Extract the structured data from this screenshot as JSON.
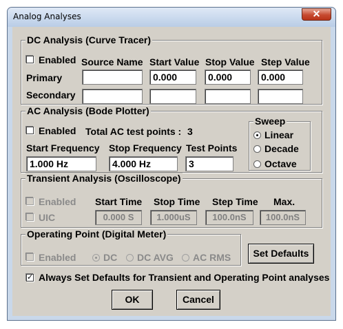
{
  "window": {
    "title": "Analog Analyses",
    "close_glyph": "✕"
  },
  "dc": {
    "legend": "DC Analysis  (Curve Tracer)",
    "enabled_label": "Enabled",
    "headers": {
      "source_name": "Source Name",
      "start_value": "Start Value",
      "stop_value": "Stop Value",
      "step_value": "Step Value"
    },
    "primary_label": "Primary",
    "secondary_label": "Secondary",
    "primary": {
      "source": "",
      "start": "0.000",
      "stop": "0.000",
      "step": "0.000"
    },
    "secondary": {
      "source": "",
      "start": "",
      "stop": "",
      "step": ""
    }
  },
  "ac": {
    "legend": "AC Analysis  (Bode Plotter)",
    "enabled_label": "Enabled",
    "total_label": "Total  AC test points :",
    "total_value": "3",
    "start_freq_label": "Start Frequency",
    "stop_freq_label": "Stop Frequency",
    "test_points_label": "Test Points",
    "start_freq": "1.000 Hz",
    "stop_freq": "4.000 Hz",
    "test_points": "3",
    "sweep": {
      "legend": "Sweep",
      "options": [
        "Linear",
        "Decade",
        "Octave"
      ],
      "selected": "Linear"
    }
  },
  "transient": {
    "legend": "Transient Analysis  (Oscilloscope)",
    "enabled_label": "Enabled",
    "uic_label": "UIC",
    "headers": {
      "start": "Start Time",
      "stop": "Stop Time",
      "step": "Step Time",
      "max": "Max."
    },
    "values": {
      "start": "0.000 S",
      "stop": "1.000uS",
      "step": "100.0nS",
      "max": "100.0nS"
    }
  },
  "op": {
    "legend": "Operating Point  (Digital Meter)",
    "enabled_label": "Enabled",
    "options": [
      "DC",
      "DC AVG",
      "AC RMS"
    ],
    "selected": "DC"
  },
  "set_defaults_label": "Set Defaults",
  "always_label": "Always Set Defaults for Transient and Operating Point analyses",
  "ok_label": "OK",
  "cancel_label": "Cancel"
}
